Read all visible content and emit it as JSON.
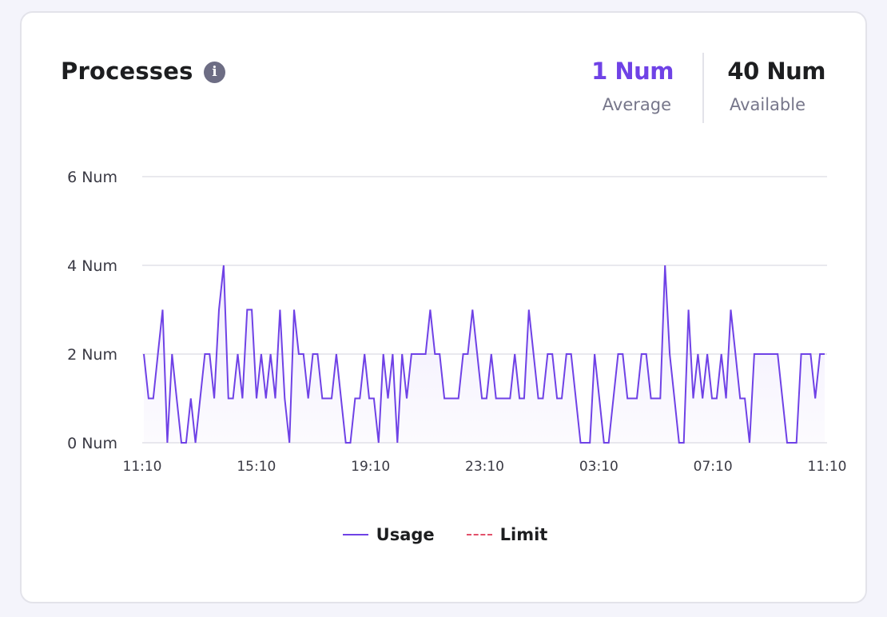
{
  "header": {
    "title": "Processes",
    "info_icon": "info-icon"
  },
  "stats": {
    "average": {
      "value": "1 Num",
      "label": "Average",
      "color": "#6f42e6"
    },
    "available": {
      "value": "40 Num",
      "label": "Available"
    }
  },
  "chart_data": {
    "type": "area",
    "ylim": [
      0,
      6
    ],
    "y_ticks": [
      {
        "value": 0,
        "label": "0 Num"
      },
      {
        "value": 2,
        "label": "2 Num"
      },
      {
        "value": 4,
        "label": "4 Num"
      },
      {
        "value": 6,
        "label": "6 Num"
      }
    ],
    "x_ticks": [
      "11:10",
      "15:10",
      "19:10",
      "23:10",
      "03:10",
      "07:10",
      "11:10"
    ],
    "grid": true,
    "legend_placement": "bottom-center",
    "series": [
      {
        "name": "Usage",
        "color": "#6f42e6",
        "style": "solid",
        "values": [
          2,
          1,
          1,
          2,
          3,
          0,
          2,
          1,
          0,
          0,
          1,
          0,
          1,
          2,
          2,
          1,
          3,
          4,
          1,
          1,
          2,
          1,
          3,
          3,
          1,
          2,
          1,
          2,
          1,
          3,
          1,
          0,
          3,
          2,
          2,
          1,
          2,
          2,
          1,
          1,
          1,
          2,
          1,
          0,
          0,
          1,
          1,
          2,
          1,
          1,
          0,
          2,
          1,
          2,
          0,
          2,
          1,
          2,
          2,
          2,
          2,
          3,
          2,
          2,
          1,
          1,
          1,
          1,
          2,
          2,
          3,
          2,
          1,
          1,
          2,
          1,
          1,
          1,
          1,
          2,
          1,
          1,
          3,
          2,
          1,
          1,
          2,
          2,
          1,
          1,
          2,
          2,
          1,
          0,
          0,
          0,
          2,
          1,
          0,
          0,
          1,
          2,
          2,
          1,
          1,
          1,
          2,
          2,
          1,
          1,
          1,
          4,
          2,
          1,
          0,
          0,
          3,
          1,
          2,
          1,
          2,
          1,
          1,
          2,
          1,
          3,
          2,
          1,
          1,
          0,
          2,
          2,
          2,
          2,
          2,
          2,
          1,
          0,
          0,
          0,
          2,
          2,
          2,
          1,
          2,
          2
        ]
      },
      {
        "name": "Limit",
        "color": "#e2506a",
        "style": "dashed",
        "values": []
      }
    ]
  }
}
